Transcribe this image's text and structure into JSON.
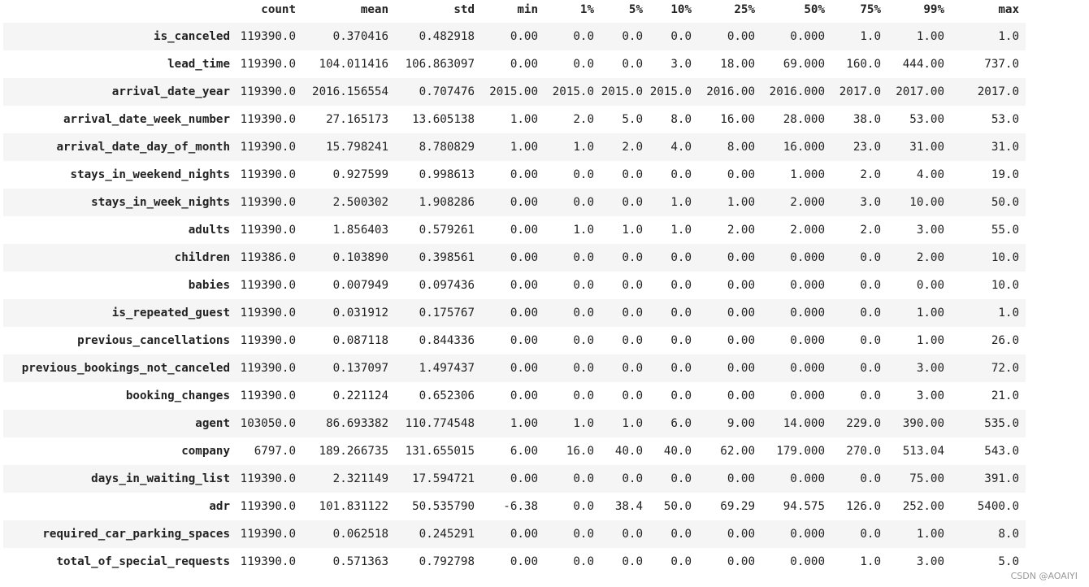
{
  "columns": [
    "count",
    "mean",
    "std",
    "min",
    "1%",
    "5%",
    "10%",
    "25%",
    "50%",
    "75%",
    "99%",
    "max"
  ],
  "rows": [
    {
      "label": "is_canceled",
      "values": [
        "119390.0",
        "0.370416",
        "0.482918",
        "0.00",
        "0.0",
        "0.0",
        "0.0",
        "0.00",
        "0.000",
        "1.0",
        "1.00",
        "1.0"
      ]
    },
    {
      "label": "lead_time",
      "values": [
        "119390.0",
        "104.011416",
        "106.863097",
        "0.00",
        "0.0",
        "0.0",
        "3.0",
        "18.00",
        "69.000",
        "160.0",
        "444.00",
        "737.0"
      ]
    },
    {
      "label": "arrival_date_year",
      "values": [
        "119390.0",
        "2016.156554",
        "0.707476",
        "2015.00",
        "2015.0",
        "2015.0",
        "2015.0",
        "2016.00",
        "2016.000",
        "2017.0",
        "2017.00",
        "2017.0"
      ]
    },
    {
      "label": "arrival_date_week_number",
      "values": [
        "119390.0",
        "27.165173",
        "13.605138",
        "1.00",
        "2.0",
        "5.0",
        "8.0",
        "16.00",
        "28.000",
        "38.0",
        "53.00",
        "53.0"
      ]
    },
    {
      "label": "arrival_date_day_of_month",
      "values": [
        "119390.0",
        "15.798241",
        "8.780829",
        "1.00",
        "1.0",
        "2.0",
        "4.0",
        "8.00",
        "16.000",
        "23.0",
        "31.00",
        "31.0"
      ]
    },
    {
      "label": "stays_in_weekend_nights",
      "values": [
        "119390.0",
        "0.927599",
        "0.998613",
        "0.00",
        "0.0",
        "0.0",
        "0.0",
        "0.00",
        "1.000",
        "2.0",
        "4.00",
        "19.0"
      ]
    },
    {
      "label": "stays_in_week_nights",
      "values": [
        "119390.0",
        "2.500302",
        "1.908286",
        "0.00",
        "0.0",
        "0.0",
        "1.0",
        "1.00",
        "2.000",
        "3.0",
        "10.00",
        "50.0"
      ]
    },
    {
      "label": "adults",
      "values": [
        "119390.0",
        "1.856403",
        "0.579261",
        "0.00",
        "1.0",
        "1.0",
        "1.0",
        "2.00",
        "2.000",
        "2.0",
        "3.00",
        "55.0"
      ]
    },
    {
      "label": "children",
      "values": [
        "119386.0",
        "0.103890",
        "0.398561",
        "0.00",
        "0.0",
        "0.0",
        "0.0",
        "0.00",
        "0.000",
        "0.0",
        "2.00",
        "10.0"
      ]
    },
    {
      "label": "babies",
      "values": [
        "119390.0",
        "0.007949",
        "0.097436",
        "0.00",
        "0.0",
        "0.0",
        "0.0",
        "0.00",
        "0.000",
        "0.0",
        "0.00",
        "10.0"
      ]
    },
    {
      "label": "is_repeated_guest",
      "values": [
        "119390.0",
        "0.031912",
        "0.175767",
        "0.00",
        "0.0",
        "0.0",
        "0.0",
        "0.00",
        "0.000",
        "0.0",
        "1.00",
        "1.0"
      ]
    },
    {
      "label": "previous_cancellations",
      "values": [
        "119390.0",
        "0.087118",
        "0.844336",
        "0.00",
        "0.0",
        "0.0",
        "0.0",
        "0.00",
        "0.000",
        "0.0",
        "1.00",
        "26.0"
      ]
    },
    {
      "label": "previous_bookings_not_canceled",
      "values": [
        "119390.0",
        "0.137097",
        "1.497437",
        "0.00",
        "0.0",
        "0.0",
        "0.0",
        "0.00",
        "0.000",
        "0.0",
        "3.00",
        "72.0"
      ]
    },
    {
      "label": "booking_changes",
      "values": [
        "119390.0",
        "0.221124",
        "0.652306",
        "0.00",
        "0.0",
        "0.0",
        "0.0",
        "0.00",
        "0.000",
        "0.0",
        "3.00",
        "21.0"
      ]
    },
    {
      "label": "agent",
      "values": [
        "103050.0",
        "86.693382",
        "110.774548",
        "1.00",
        "1.0",
        "1.0",
        "6.0",
        "9.00",
        "14.000",
        "229.0",
        "390.00",
        "535.0"
      ]
    },
    {
      "label": "company",
      "values": [
        "6797.0",
        "189.266735",
        "131.655015",
        "6.00",
        "16.0",
        "40.0",
        "40.0",
        "62.00",
        "179.000",
        "270.0",
        "513.04",
        "543.0"
      ]
    },
    {
      "label": "days_in_waiting_list",
      "values": [
        "119390.0",
        "2.321149",
        "17.594721",
        "0.00",
        "0.0",
        "0.0",
        "0.0",
        "0.00",
        "0.000",
        "0.0",
        "75.00",
        "391.0"
      ]
    },
    {
      "label": "adr",
      "values": [
        "119390.0",
        "101.831122",
        "50.535790",
        "-6.38",
        "0.0",
        "38.4",
        "50.0",
        "69.29",
        "94.575",
        "126.0",
        "252.00",
        "5400.0"
      ]
    },
    {
      "label": "required_car_parking_spaces",
      "values": [
        "119390.0",
        "0.062518",
        "0.245291",
        "0.00",
        "0.0",
        "0.0",
        "0.0",
        "0.00",
        "0.000",
        "0.0",
        "1.00",
        "8.0"
      ]
    },
    {
      "label": "total_of_special_requests",
      "values": [
        "119390.0",
        "0.571363",
        "0.792798",
        "0.00",
        "0.0",
        "0.0",
        "0.0",
        "0.00",
        "0.000",
        "1.0",
        "3.00",
        "5.0"
      ]
    }
  ],
  "watermark": "CSDN @AOAIYI"
}
